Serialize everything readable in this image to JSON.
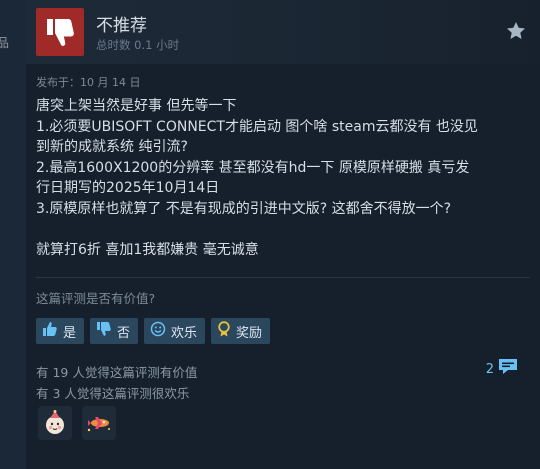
{
  "edge_char": "品",
  "review": {
    "verdict": "不推荐",
    "hours": "总时数 0.1 小时",
    "posted": "发布于：10 月 14 日",
    "body_lines": [
      "唐突上架当然是好事 但先等一下",
      "1.必须要UBISOFT CONNECT才能启动 图个啥 steam云都没有 也没见",
      "到新的成就系统 纯引流?",
      "2.最高1600X1200的分辨率 甚至都没有hd一下 原模原样硬搬 真亏发",
      "行日期写的2025年10月14日",
      "3.原模原样也就算了 不是有现成的引进中文版? 这都舍不得放一个?",
      "",
      "就算打6折 喜加1我都嫌贵 毫无诚意"
    ]
  },
  "helpful": {
    "question": "这篇评测是否有价值?",
    "buttons": {
      "yes": "是",
      "no": "否",
      "funny": "欢乐",
      "award": "奖励"
    },
    "stat_helpful": "有 19 人觉得这篇评测有价值",
    "stat_funny": "有 3 人觉得这篇评测很欢乐",
    "comment_count": "2"
  },
  "colors": {
    "background": "#1b2838",
    "thumb_red": "#a02a28",
    "accent_blue": "#67c1f5",
    "button_bg": "#2a475e"
  },
  "icons": [
    "thumbs-down-icon",
    "star-icon",
    "thumbs-up-icon",
    "smile-icon",
    "award-ribbon-icon",
    "comment-icon",
    "award-face-icon",
    "award-plane-icon"
  ]
}
